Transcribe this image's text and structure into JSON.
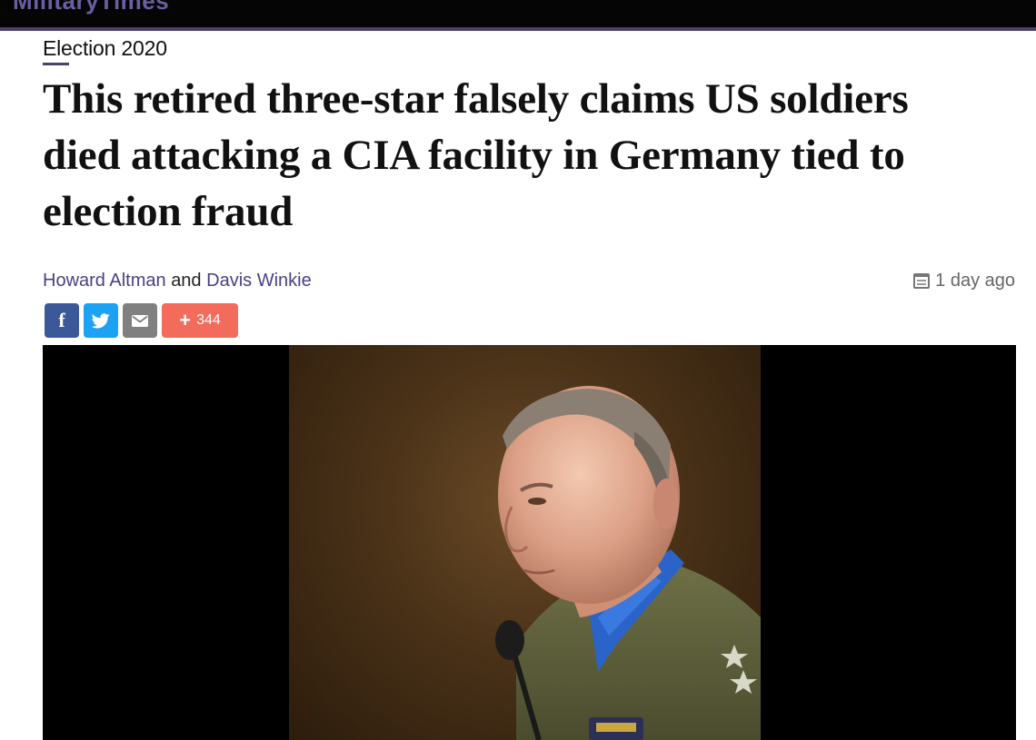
{
  "site": {
    "logo_text": "MilitaryTimes"
  },
  "article": {
    "kicker": "Election 2020",
    "headline": "This retired three-star falsely claims US soldiers died attacking a CIA facility in Germany tied to election fraud",
    "authors": [
      "Howard Altman",
      "Davis Winkie"
    ],
    "author_conjunction": "and",
    "timestamp": "1 day ago"
  },
  "share": {
    "facebook_icon": "f",
    "count": "344",
    "plus_icon": "+"
  },
  "colors": {
    "brand": "#4a3f6e",
    "facebook": "#3b5998",
    "twitter": "#1da1f2",
    "email": "#808080",
    "share_count": "#f26b5b"
  },
  "icons": [
    "calendar-icon",
    "facebook-icon",
    "twitter-icon",
    "email-icon",
    "plus-icon"
  ]
}
